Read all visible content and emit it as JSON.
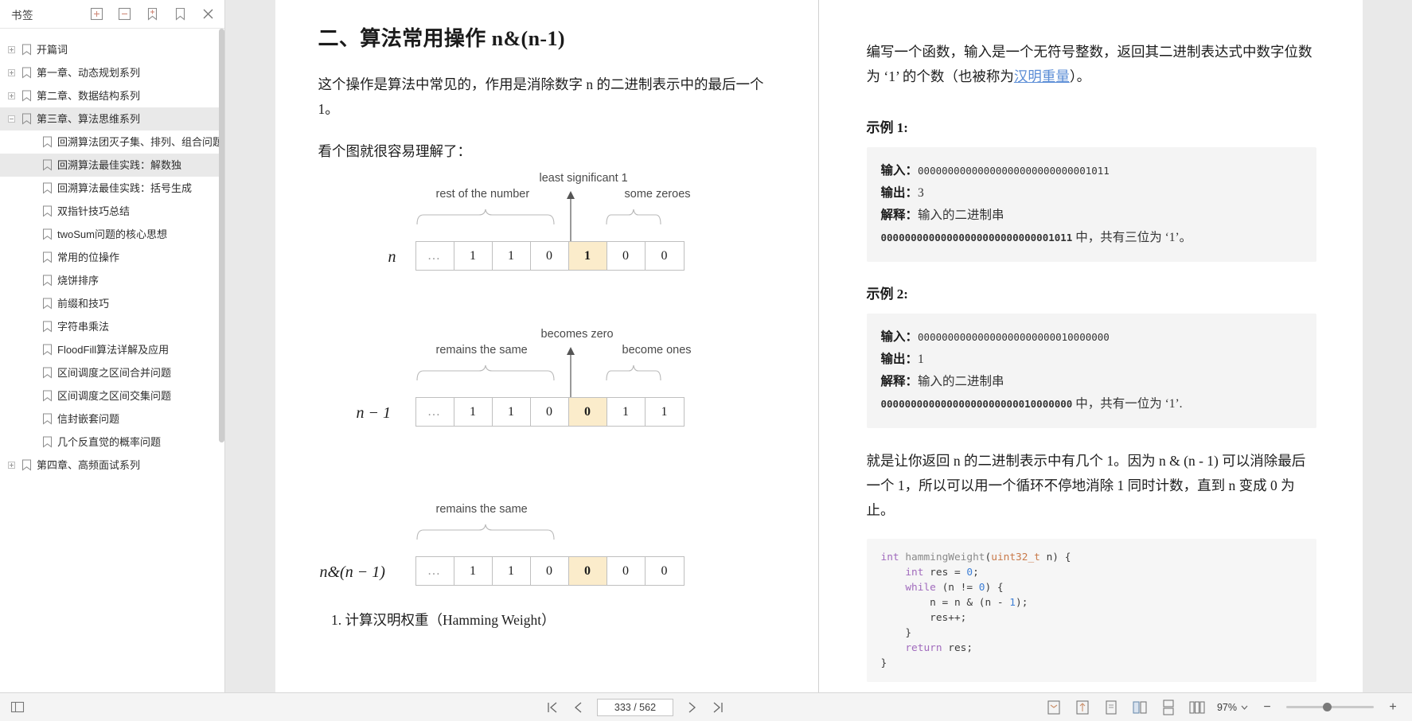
{
  "sidebar": {
    "title": "书签",
    "tools": [
      {
        "name": "expand-all-icon",
        "glyph": "expand-all"
      },
      {
        "name": "collapse-all-icon",
        "glyph": "collapse-all"
      },
      {
        "name": "add-bookmark-icon",
        "glyph": "add-bookmark"
      },
      {
        "name": "bookmark-icon",
        "glyph": "bookmark"
      },
      {
        "name": "close-icon",
        "glyph": "close"
      }
    ],
    "items": [
      {
        "label": "开篇词",
        "level": 1,
        "expander": "plus",
        "selected": false
      },
      {
        "label": "第一章、动态规划系列",
        "level": 1,
        "expander": "plus",
        "selected": false
      },
      {
        "label": "第二章、数据结构系列",
        "level": 1,
        "expander": "plus",
        "selected": false
      },
      {
        "label": "第三章、算法思维系列",
        "level": 1,
        "expander": "minus",
        "selected": true
      },
      {
        "label": "回溯算法团灭子集、排列、组合问题",
        "level": 2,
        "expander": "none",
        "selected": false
      },
      {
        "label": "回溯算法最佳实践：解数独",
        "level": 2,
        "expander": "none",
        "selected": true
      },
      {
        "label": "回溯算法最佳实践：括号生成",
        "level": 2,
        "expander": "none",
        "selected": false
      },
      {
        "label": "双指针技巧总结",
        "level": 2,
        "expander": "none",
        "selected": false
      },
      {
        "label": "twoSum问题的核心思想",
        "level": 2,
        "expander": "none",
        "selected": false
      },
      {
        "label": "常用的位操作",
        "level": 2,
        "expander": "none",
        "selected": false
      },
      {
        "label": "烧饼排序",
        "level": 2,
        "expander": "none",
        "selected": false
      },
      {
        "label": "前缀和技巧",
        "level": 2,
        "expander": "none",
        "selected": false
      },
      {
        "label": "字符串乘法",
        "level": 2,
        "expander": "none",
        "selected": false
      },
      {
        "label": "FloodFill算法详解及应用",
        "level": 2,
        "expander": "none",
        "selected": false
      },
      {
        "label": "区间调度之区间合并问题",
        "level": 2,
        "expander": "none",
        "selected": false
      },
      {
        "label": "区间调度之区间交集问题",
        "level": 2,
        "expander": "none",
        "selected": false
      },
      {
        "label": "信封嵌套问题",
        "level": 2,
        "expander": "none",
        "selected": false
      },
      {
        "label": "几个反直觉的概率问题",
        "level": 2,
        "expander": "none",
        "selected": false
      },
      {
        "label": "第四章、高频面试系列",
        "level": 1,
        "expander": "plus",
        "selected": false
      }
    ]
  },
  "document": {
    "heading": "二、算法常用操作 n&(n-1)",
    "para1": "这个操作是算法中常见的，作用是消除数字 n 的二进制表示中的最后一个 1。",
    "para2": "看个图就很容易理解了：",
    "figure": {
      "rows": [
        {
          "rowlabel": "n",
          "left_label": "rest of the number",
          "center_label": "least significant 1",
          "right_label": "some zeroes",
          "bits": [
            "…",
            "1",
            "1",
            "0",
            "1",
            "0",
            "0"
          ],
          "highlight_index": 4
        },
        {
          "rowlabel": "n − 1",
          "left_label": "remains the same",
          "center_label": "becomes zero",
          "right_label": "become ones",
          "bits": [
            "…",
            "1",
            "1",
            "0",
            "0",
            "1",
            "1"
          ],
          "highlight_index": 4
        },
        {
          "rowlabel": "n&(n − 1)",
          "left_label": "remains the same",
          "center_label": "",
          "right_label": "",
          "bits": [
            "…",
            "1",
            "1",
            "0",
            "0",
            "0",
            "0"
          ],
          "highlight_index": 4
        }
      ]
    },
    "list_item_1": "计算汉明权重（Hamming Weight）"
  },
  "right_page": {
    "quote_part1": "编写一个函数，输入是一个无符号整数，返回其二进制表达式中数字位数为 ‘1’ 的个数（也被称为",
    "quote_link": "汉明重量",
    "quote_part2": "）。",
    "example1_title": "示例 1:",
    "example1": {
      "input_label": "输入：",
      "input_value": "00000000000000000000000000001011",
      "output_label": "输出：",
      "output_value": "3",
      "explain_label": "解释：",
      "explain_text": "输入的二进制串",
      "explain_binary": "00000000000000000000000000001011",
      "explain_tail": "中，共有三位为 ‘1’。"
    },
    "example2_title": "示例 2:",
    "example2": {
      "input_label": "输入：",
      "input_value": "00000000000000000000000010000000",
      "output_label": "输出：",
      "output_value": "1",
      "explain_label": "解释：",
      "explain_text": "输入的二进制串",
      "explain_binary": "00000000000000000000000010000000",
      "explain_tail": "中，共有一位为 ‘1’."
    },
    "closing_para": "就是让你返回 n 的二进制表示中有几个 1。因为 n & (n - 1) 可以消除最后一个 1，所以可以用一个循环不停地消除 1 同时计数，直到 n 变成 0 为止。",
    "code": "int hammingWeight(uint32_t n) {\n    int res = 0;\n    while (n != 0) {\n        n = n & (n - 1);\n        res++;\n    }\n    return res;\n}"
  },
  "bottombar": {
    "page_indicator": "333 / 562",
    "zoom_level": "97%",
    "nav": [
      {
        "name": "first-page-button",
        "glyph": "first"
      },
      {
        "name": "previous-page-button",
        "glyph": "prev"
      },
      {
        "name": "next-page-button",
        "glyph": "next"
      },
      {
        "name": "last-page-button",
        "glyph": "last"
      }
    ],
    "view_tools": [
      {
        "name": "fit-page-icon"
      },
      {
        "name": "fit-width-icon"
      },
      {
        "name": "single-page-icon"
      },
      {
        "name": "facing-page-icon"
      },
      {
        "name": "continuous-page-icon"
      },
      {
        "name": "book-view-icon"
      }
    ],
    "zoom_out_label": "−",
    "zoom_in_label": "+"
  }
}
